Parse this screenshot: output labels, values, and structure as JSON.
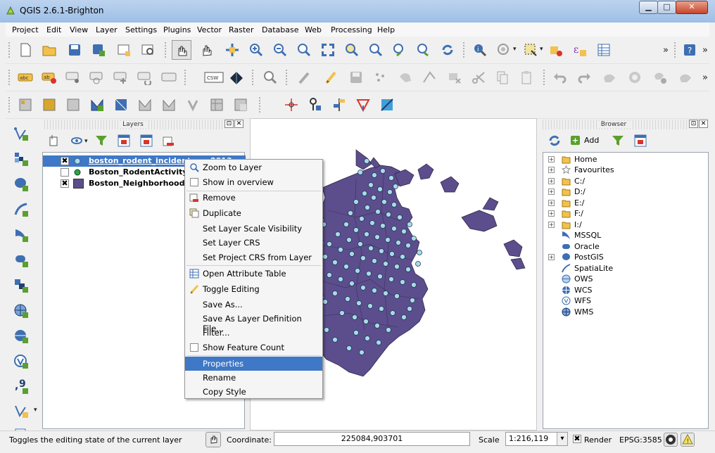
{
  "window": {
    "title": "QGIS 2.6.1-Brighton",
    "min": "▁",
    "max": "□",
    "close": "✕"
  },
  "menu": [
    "Project",
    "Edit",
    "View",
    "Layer",
    "Settings",
    "Plugins",
    "Vector",
    "Raster",
    "Database",
    "Web",
    "Processing",
    "Help"
  ],
  "toolbar": {
    "more": "»",
    "more2": "»",
    "more3": "»",
    "csw": "CSW",
    "abc": "abc",
    "ab": "ab",
    "help": "?",
    "epsilon": "ε",
    "drop": "▾"
  },
  "layers_panel": {
    "title": "Layers",
    "float": "⊡",
    "close": "✕",
    "layers": [
      {
        "name": "boston_rodent_incidents...",
        "extra": "2013",
        "checked": "✖",
        "selected": true
      },
      {
        "name": "Boston_RodentActivity_",
        "checked": "",
        "selected": false
      },
      {
        "name": "Boston_Neighborhoods",
        "checked": "✖",
        "selected": false
      }
    ]
  },
  "context_menu": {
    "items": [
      {
        "label": "Zoom to Layer",
        "icon": "zoom-to-layer-icon"
      },
      {
        "label": "Show in overview",
        "icon": "checkbox-icon"
      },
      {
        "label": "Remove",
        "icon": "remove-layer-icon"
      },
      {
        "label": "Duplicate",
        "icon": "duplicate-layer-icon"
      },
      {
        "label": "Set Layer Scale Visibility",
        "icon": ""
      },
      {
        "label": "Set Layer CRS",
        "icon": ""
      },
      {
        "label": "Set Project CRS from Layer",
        "icon": ""
      },
      {
        "label": "Open Attribute Table",
        "icon": "attribute-table-icon"
      },
      {
        "label": "Toggle Editing",
        "icon": "pencil-icon"
      },
      {
        "label": "Save As...",
        "icon": ""
      },
      {
        "label": "Save As Layer Definition File...",
        "icon": ""
      },
      {
        "label": "Filter...",
        "icon": ""
      },
      {
        "label": "Show Feature Count",
        "icon": "checkbox-icon"
      },
      {
        "label": "Properties",
        "icon": "",
        "selected": true
      },
      {
        "label": "Rename",
        "icon": ""
      },
      {
        "label": "Copy Style",
        "icon": ""
      }
    ]
  },
  "browser_panel": {
    "title": "Browser",
    "add_label": "Add",
    "float": "⊡",
    "close": "✕",
    "items": [
      {
        "label": "Home",
        "expand": "+",
        "icon": "folder-icon"
      },
      {
        "label": "Favourites",
        "expand": "+",
        "icon": "star-icon"
      },
      {
        "label": "C:/",
        "expand": "+",
        "icon": "folder-icon"
      },
      {
        "label": "D:/",
        "expand": "+",
        "icon": "folder-icon"
      },
      {
        "label": "E:/",
        "expand": "+",
        "icon": "folder-icon"
      },
      {
        "label": "F:/",
        "expand": "+",
        "icon": "folder-icon"
      },
      {
        "label": "I:/",
        "expand": "+",
        "icon": "folder-icon"
      },
      {
        "label": "MSSQL",
        "expand": "",
        "icon": "mssql-icon"
      },
      {
        "label": "Oracle",
        "expand": "",
        "icon": "oracle-icon"
      },
      {
        "label": "PostGIS",
        "expand": "+",
        "icon": "postgis-icon"
      },
      {
        "label": "SpatiaLite",
        "expand": "",
        "icon": "spatialite-icon"
      },
      {
        "label": "OWS",
        "expand": "",
        "icon": "ows-icon"
      },
      {
        "label": "WCS",
        "expand": "",
        "icon": "wcs-icon"
      },
      {
        "label": "WFS",
        "expand": "",
        "icon": "wfs-icon"
      },
      {
        "label": "WMS",
        "expand": "",
        "icon": "wms-icon"
      }
    ]
  },
  "statusbar": {
    "message": "Toggles the editing state of the current layer",
    "coordinate_label": "Coordinate:",
    "coordinate_value": "225084,903701",
    "scale_label": "Scale",
    "scale_value": "1:216,119",
    "render_check": "✖",
    "render_label": "Render",
    "crs": "EPSG:3585",
    "scale_drop": "▾",
    "warn": "!"
  },
  "colors": {
    "map_fill": "#5c4d8d",
    "point_fill": "#a9dbe4",
    "selection": "#3f78c6",
    "title_bar": "#a7c5ea"
  }
}
